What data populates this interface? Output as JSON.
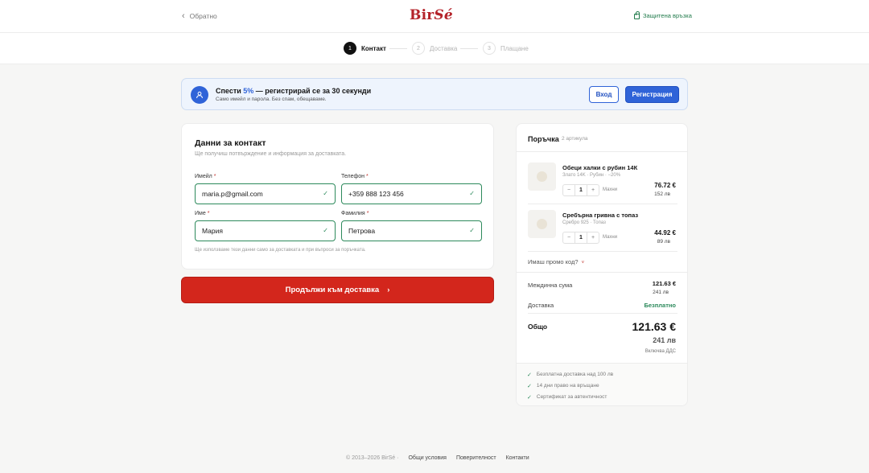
{
  "header": {
    "back_label": "Обратно",
    "logo_left": "Bir",
    "logo_right": "Sé",
    "secure_label": "Защитена връзка",
    "brand_color": "#b4232a"
  },
  "stepper": {
    "steps": [
      {
        "num": "1",
        "label": "Контакт"
      },
      {
        "num": "2",
        "label": "Доставка"
      },
      {
        "num": "3",
        "label": "Плащане"
      }
    ]
  },
  "banner": {
    "title_pre": "Спести ",
    "title_pct": "5%",
    "title_post": " — регистрирай се за 30 секунди",
    "subtitle": "Само имейл и парола. Без спам, обещаваме.",
    "login_label": "Вход",
    "register_label": "Регистрация",
    "accent_color": "#2f63d8"
  },
  "contact": {
    "heading": "Данни за контакт",
    "description": "Ще получиш потвърждение и информация за доставката.",
    "email_label": "Имейл",
    "email_value": "maria.p@gmail.com",
    "phone_label": "Телефон",
    "phone_value": "+359 888 123 456",
    "first_name_label": "Име",
    "first_name_value": "Мария",
    "last_name_label": "Фамилия",
    "last_name_value": "Петрова",
    "required_mark": "*",
    "note": "Ще използваме тези данни само за доставката и при въпроси за поръчката."
  },
  "continue_button": {
    "label": "Продължи към доставка",
    "arrow": "›",
    "color": "#d3261c"
  },
  "order": {
    "heading": "Поръчка",
    "count": "2 артикула",
    "items": [
      {
        "name": "Обеци халки с рубин 14К",
        "meta": "Злато 14K · Рубин · −20%",
        "qty": "1",
        "remove": "Махни",
        "price_eur": "76.72 €",
        "price_bgn": "152 лв"
      },
      {
        "name": "Сребърна гривна с топаз",
        "meta": "Сребро 925 · Топаз",
        "qty": "1",
        "remove": "Махни",
        "price_eur": "44.92 €",
        "price_bgn": "89 лв"
      }
    ],
    "promo_label": "Имаш промо код?",
    "subtotal_label": "Междинна сума",
    "subtotal_eur": "121.63 €",
    "subtotal_bgn": "241 лв",
    "shipping_label": "Доставка",
    "shipping_value": "Безплатно",
    "total_label": "Общо",
    "total_eur": "121.63 €",
    "total_bgn": "241 лв",
    "vat_label": "Включва ДДС",
    "perks": [
      "Безплатна доставка над 100 лв",
      "14 дни право на връщане",
      "Сертификат за автентичност"
    ]
  },
  "footer": {
    "copyright": "© 2013–2026 BirSé ·",
    "links": [
      "Общи условия",
      "Поверителност",
      "Контакти"
    ]
  }
}
